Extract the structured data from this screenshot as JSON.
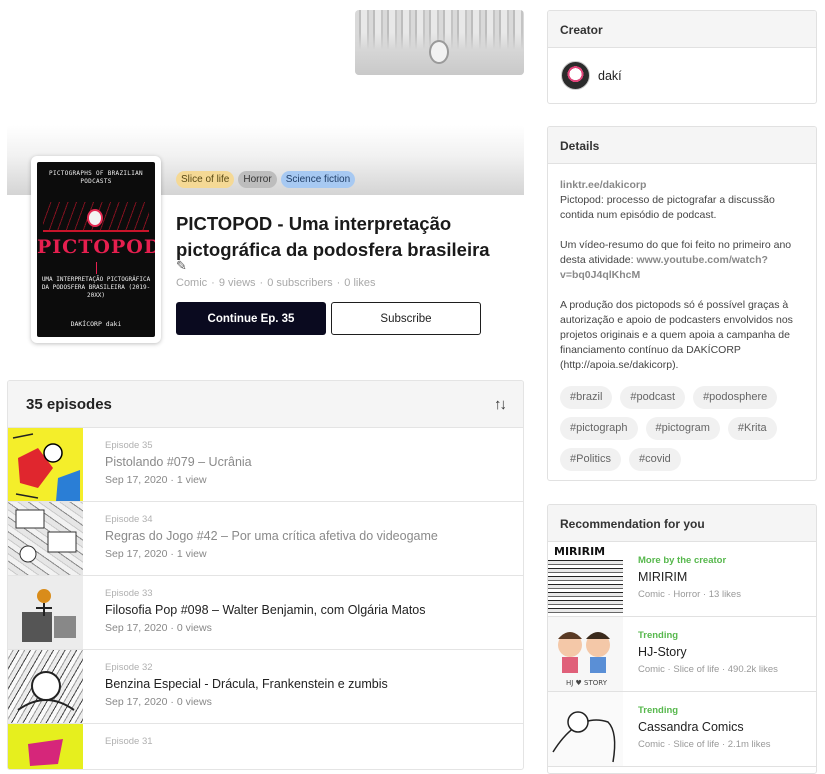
{
  "series": {
    "title": "PICTOPOD - Uma interpretação pictográfica da podosfera brasileira",
    "genres": [
      {
        "label": "Slice of life",
        "color": "#f5d995",
        "text": "#5a4a14"
      },
      {
        "label": "Horror",
        "color": "#bdbdbd",
        "text": "#333333"
      },
      {
        "label": "Science fiction",
        "color": "#a7c9f2",
        "text": "#1f3d66"
      }
    ],
    "meta": {
      "type": "Comic",
      "views": "9 views",
      "subscribers": "0 subscribers",
      "likes": "0 likes"
    },
    "continue_label": "Continue Ep. 35",
    "subscribe_label": "Subscribe",
    "cover": {
      "top_text": "PICTOGRAPHS OF BRAZILIAN PODCASTS",
      "logo_text": "PICTOPOD",
      "sub_text": "UMA INTERPRETAÇÃO PICTOGRÁFICA DA PODOSFERA BRASILEIRA (2019-20XX)",
      "publisher": "DAKÍCORP daki"
    }
  },
  "episodes": {
    "count_label": "35 episodes",
    "items": [
      {
        "num": "Episode 35",
        "title": "Pistolando #079 – Ucrânia",
        "date": "Sep 17, 2020",
        "views": "1 view",
        "read": true
      },
      {
        "num": "Episode 34",
        "title": "Regras do Jogo #42 – Por uma crítica afetiva do videogame",
        "date": "Sep 17, 2020",
        "views": "1 view",
        "read": true
      },
      {
        "num": "Episode 33",
        "title": "Filosofia Pop #098 – Walter Benjamin, com Olgária Matos",
        "date": "Sep 17, 2020",
        "views": "0 views",
        "read": false
      },
      {
        "num": "Episode 32",
        "title": "Benzina Especial - Drácula, Frankenstein e zumbis",
        "date": "Sep 17, 2020",
        "views": "0 views",
        "read": false
      },
      {
        "num": "Episode 31",
        "title": "",
        "date": "",
        "views": "",
        "read": false
      }
    ]
  },
  "creator": {
    "heading": "Creator",
    "name": "dakí"
  },
  "details": {
    "heading": "Details",
    "link": "linktr.ee/dakicorp",
    "desc1": "Pictopod: processo de pictografar a discussão contida num episódio de podcast.",
    "desc2_prefix": "Um vídeo-resumo do que foi feito no primeiro ano desta atividade: ",
    "desc2_link": "www.youtube.com/watch?v=bq0J4qlKhcM",
    "desc3": "A produção dos pictopods só é possível graças à autorização e apoio de podcasters envolvidos nos projetos originais e a quem apoia a campanha de financiamento contínuo da DAKÍCORP (http://apoia.se/dakicorp).",
    "tags": [
      "#brazil",
      "#podcast",
      "#podosphere",
      "#pictograph",
      "#pictogram",
      "#Krita",
      "#Politics",
      "#covid"
    ]
  },
  "recommendation": {
    "heading": "Recommendation for you",
    "items": [
      {
        "tag": "More by the creator",
        "title": "MIRIRIM",
        "meta": [
          "Comic",
          "Horror",
          "13 likes"
        ]
      },
      {
        "tag": "Trending",
        "title": "HJ-Story",
        "meta": [
          "Comic",
          "Slice of life",
          "490.2k likes"
        ]
      },
      {
        "tag": "Trending",
        "title": "Cassandra Comics",
        "meta": [
          "Comic",
          "Slice of life",
          "2.1m likes"
        ]
      }
    ]
  }
}
